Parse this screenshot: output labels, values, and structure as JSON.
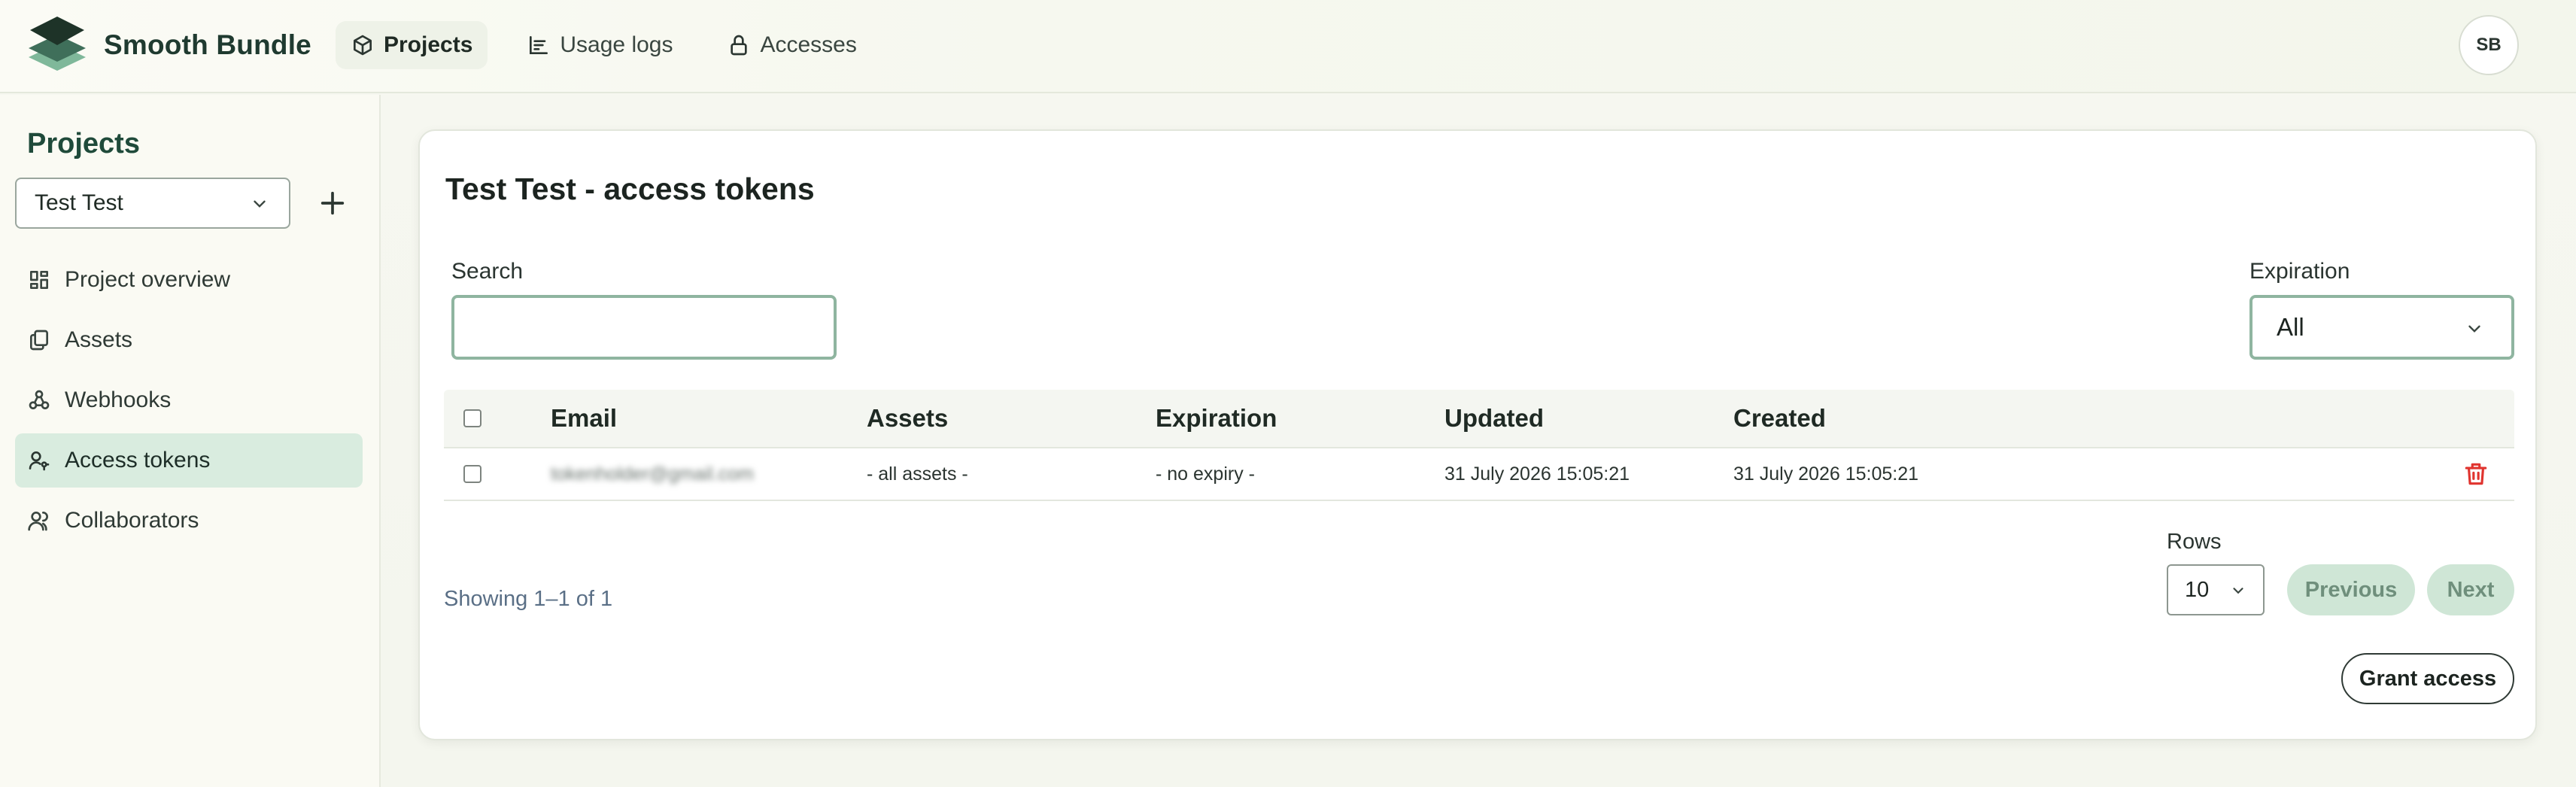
{
  "app": {
    "name": "Smooth Bundle",
    "avatar_initials": "SB"
  },
  "topnav": [
    {
      "label": "Projects",
      "icon": "cube-icon",
      "active": true
    },
    {
      "label": "Usage logs",
      "icon": "chart-icon",
      "active": false
    },
    {
      "label": "Accesses",
      "icon": "lock-icon",
      "active": false
    }
  ],
  "sidebar": {
    "title": "Projects",
    "project_select": {
      "value": "Test Test"
    },
    "items": [
      {
        "label": "Project overview",
        "icon": "dashboard-icon"
      },
      {
        "label": "Assets",
        "icon": "files-icon"
      },
      {
        "label": "Webhooks",
        "icon": "webhook-icon"
      },
      {
        "label": "Access tokens",
        "icon": "user-key-icon",
        "active": true
      },
      {
        "label": "Collaborators",
        "icon": "users-icon"
      }
    ]
  },
  "main": {
    "title": "Test Test - access tokens",
    "search": {
      "label": "Search",
      "value": "",
      "placeholder": ""
    },
    "expiration_filter": {
      "label": "Expiration",
      "value": "All"
    },
    "table": {
      "headers": [
        "Email",
        "Assets",
        "Expiration",
        "Updated",
        "Created"
      ],
      "rows": [
        {
          "email": "tokenholder@gmail.com",
          "assets": "- all assets -",
          "expiration": "- no expiry -",
          "updated": "31 July 2026 15:05:21",
          "created": "31 July 2026 15:05:21"
        }
      ]
    },
    "pagination": {
      "showing": "Showing 1–1 of 1",
      "rows_label": "Rows",
      "rows_value": "10",
      "previous": "Previous",
      "next": "Next"
    },
    "grant_access": "Grant access"
  },
  "colors": {
    "accent": "#d9ecdf",
    "input_border": "#8fb5a0",
    "danger": "#e0342f",
    "disabled_button": "#cfe6d6"
  }
}
